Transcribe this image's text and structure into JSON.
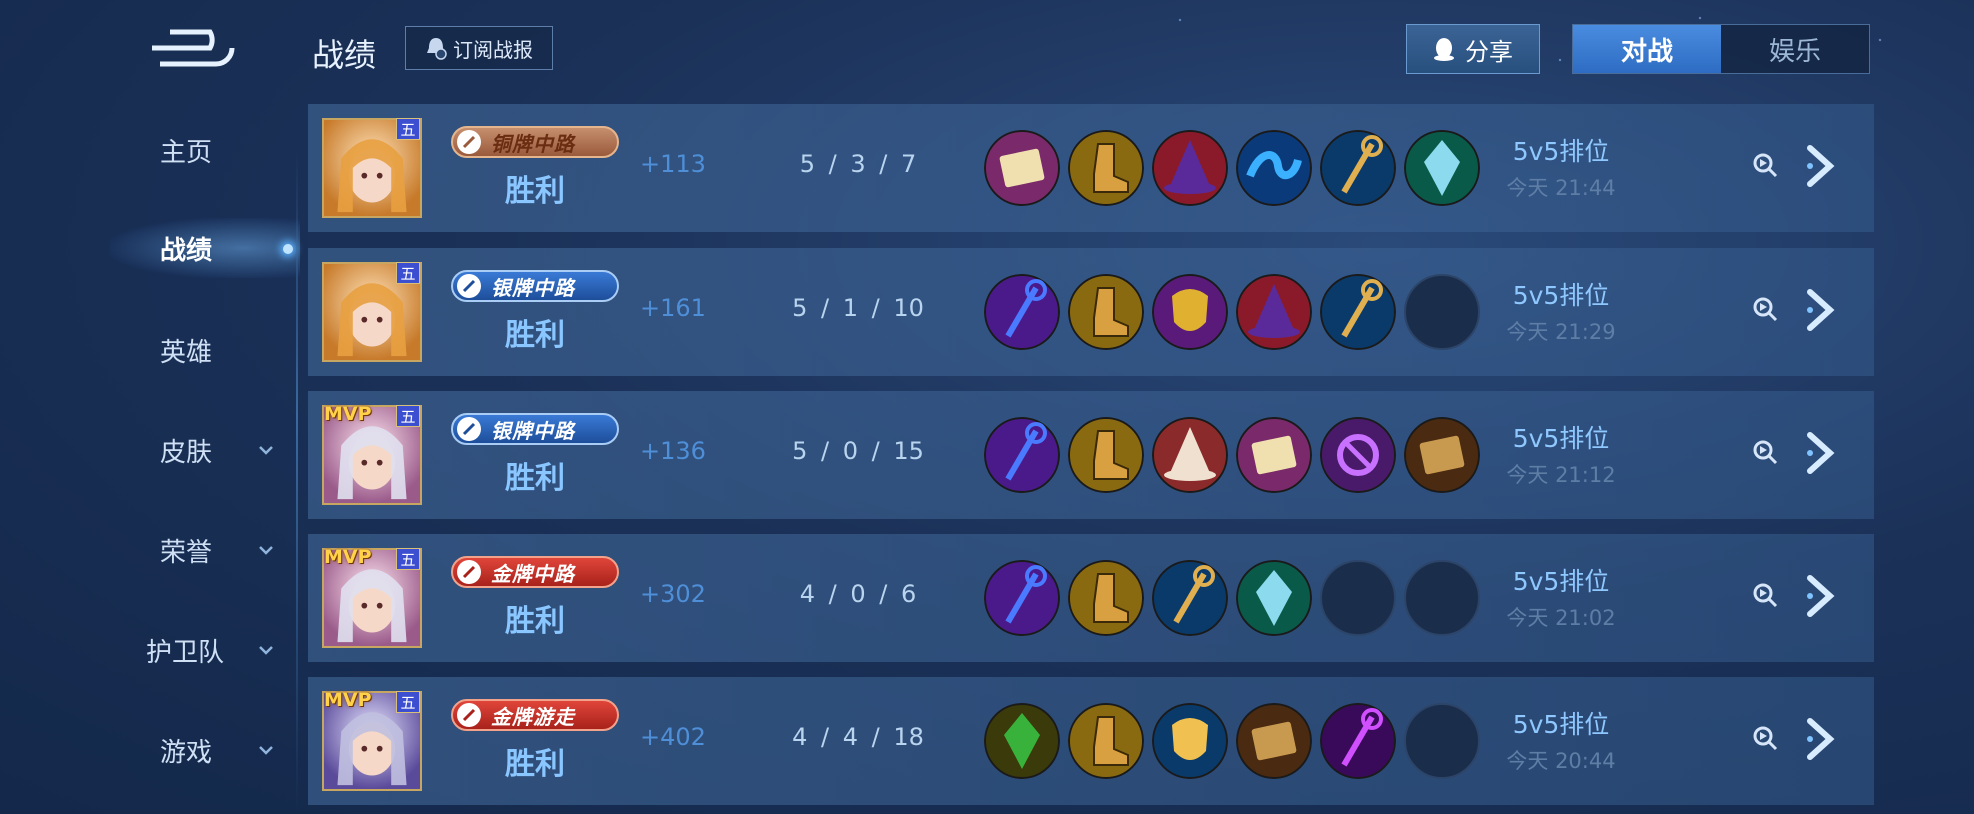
{
  "header": {
    "title": "战绩",
    "subscribe_label": "订阅战报",
    "share_label": "分享",
    "tabs": [
      {
        "label": "对战",
        "active": true
      },
      {
        "label": "娱乐",
        "active": false
      }
    ]
  },
  "sidebar": {
    "items": [
      {
        "label": "主页",
        "has_chevron": false
      },
      {
        "label": "战绩",
        "has_chevron": false,
        "active": true
      },
      {
        "label": "英雄",
        "has_chevron": false
      },
      {
        "label": "皮肤",
        "has_chevron": true
      },
      {
        "label": "荣誉",
        "has_chevron": true
      },
      {
        "label": "护卫队",
        "has_chevron": true
      },
      {
        "label": "游戏",
        "has_chevron": true
      }
    ]
  },
  "matches": [
    {
      "mvp": false,
      "tier_badge": "五",
      "rank": "铜牌中路",
      "rank_style": "bronze",
      "result": "胜利",
      "points": "+113",
      "kda": "5 / 3 / 7",
      "mode": "5v5排位",
      "time": "今天 21:44",
      "items": [
        "book-icon",
        "boots-icon",
        "magic-hat-icon",
        "blue-wave-icon",
        "staff-icon",
        "crystal-dagger-icon"
      ]
    },
    {
      "mvp": false,
      "tier_badge": "五",
      "rank": "银牌中路",
      "rank_style": "silver",
      "result": "胜利",
      "points": "+161",
      "kda": "5 / 1 / 10",
      "mode": "5v5排位",
      "time": "今天 21:29",
      "items": [
        "serpent-staff-icon",
        "boots-icon",
        "golden-mask-icon",
        "magic-hat-icon",
        "staff-icon",
        "empty-slot"
      ]
    },
    {
      "mvp": true,
      "tier_badge": "五",
      "rank": "银牌中路",
      "rank_style": "silver",
      "result": "胜利",
      "points": "+136",
      "kda": "5 / 0 / 15",
      "mode": "5v5排位",
      "time": "今天 21:12",
      "items": [
        "serpent-staff-icon",
        "boots-icon",
        "wizard-cap-icon",
        "book-icon",
        "rune-icon",
        "wooden-board-icon"
      ]
    },
    {
      "mvp": true,
      "tier_badge": "五",
      "rank": "金牌中路",
      "rank_style": "gold",
      "result": "胜利",
      "points": "+302",
      "kda": "4 / 0 / 6",
      "mode": "5v5排位",
      "time": "今天 21:02",
      "items": [
        "serpent-staff-icon",
        "boots-icon",
        "staff-icon",
        "crystal-dagger-icon",
        "empty-slot",
        "empty-slot"
      ]
    },
    {
      "mvp": true,
      "tier_badge": "五",
      "rank": "金牌游走",
      "rank_style": "gold",
      "result": "胜利",
      "points": "+402",
      "kda": "4 / 4 / 18",
      "mode": "5v5排位",
      "time": "今天 20:44",
      "items": [
        "green-amulet-icon",
        "boots-icon",
        "golden-shield-icon",
        "wooden-board-icon",
        "purple-staff-icon",
        "empty-slot"
      ]
    }
  ],
  "colors": {
    "accent": "#2d6cc2",
    "win_text": "#8ac6ff",
    "points_text": "#4e8fd8"
  }
}
